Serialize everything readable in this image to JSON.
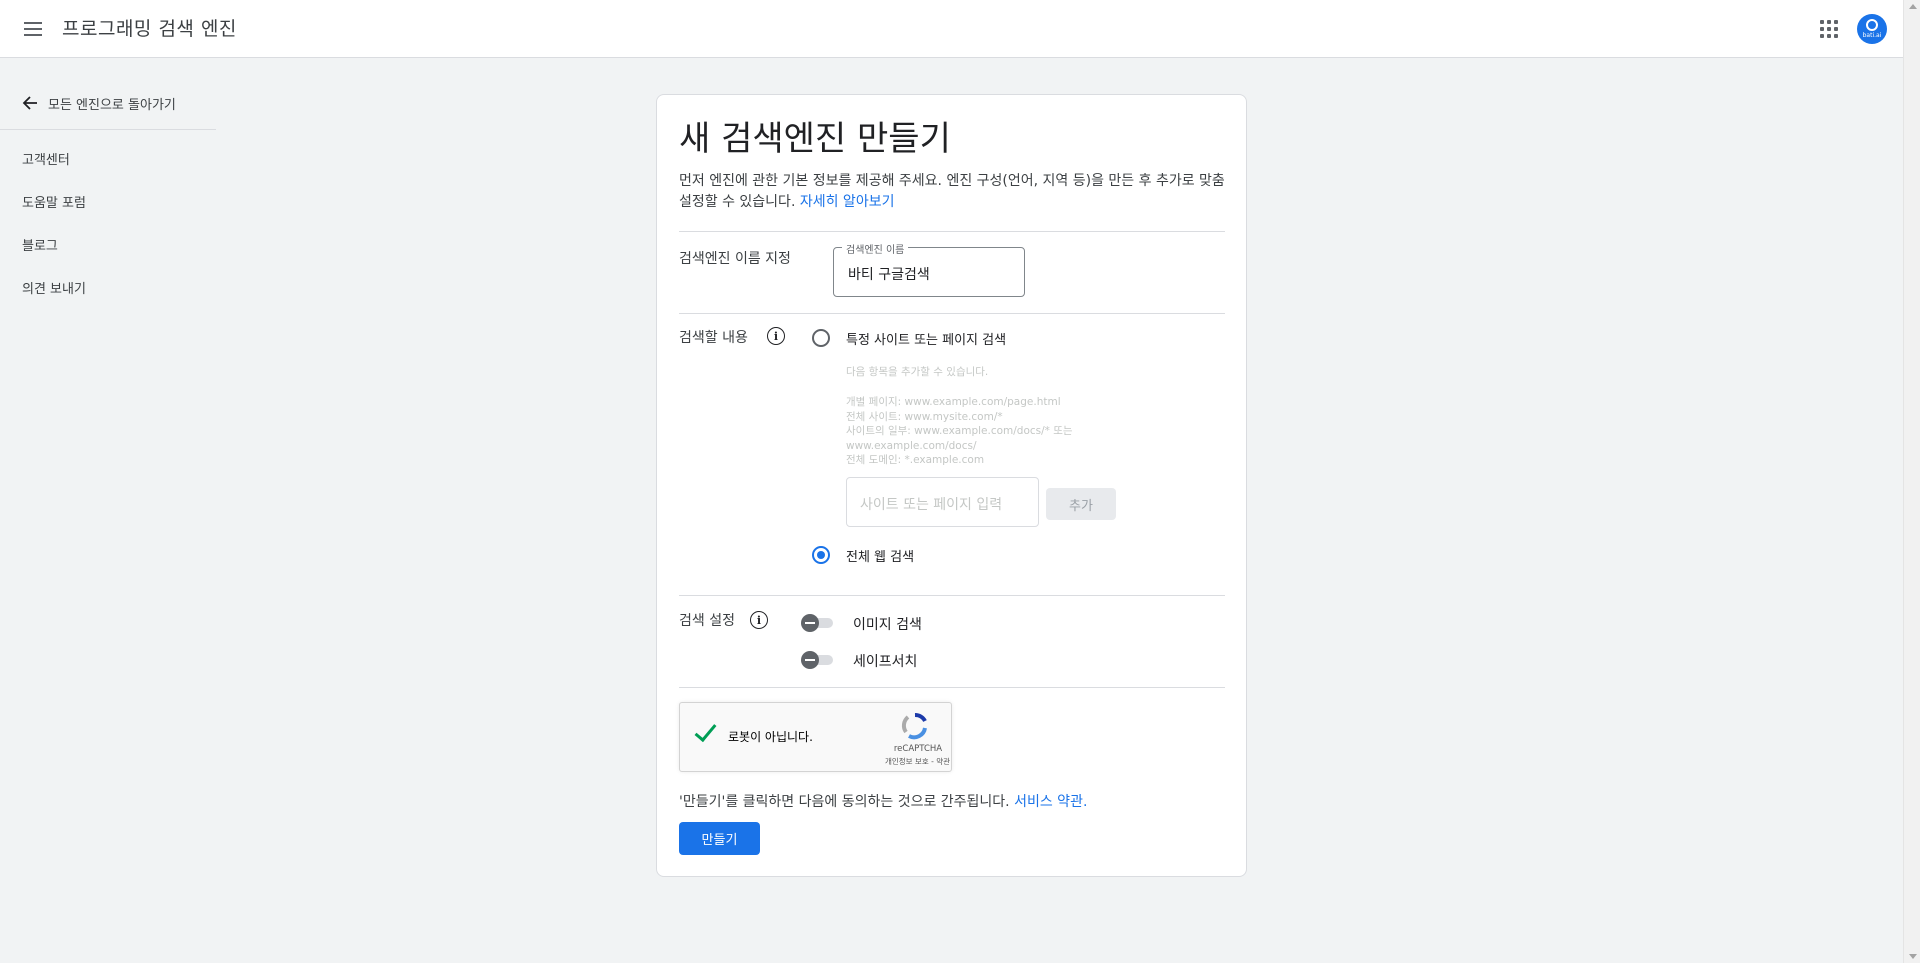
{
  "header": {
    "app_title": "프로그래밍 검색 엔진",
    "avatar_text": "bati.ai",
    "icons": {
      "menu": "hamburger-menu-icon",
      "apps": "apps-grid-icon"
    }
  },
  "sidebar": {
    "back_label": "모든 엔진으로 돌아가기",
    "items": [
      {
        "label": "고객센터"
      },
      {
        "label": "도움말 포럼"
      },
      {
        "label": "블로그"
      },
      {
        "label": "의견 보내기"
      }
    ]
  },
  "form": {
    "title": "새 검색엔진 만들기",
    "intro": "먼저 엔진에 관한 기본 정보를 제공해 주세요. 엔진 구성(언어, 지역 등)을 만든 후 추가로 맞춤설정할 수 있습니다.",
    "learn_more": "자세히 알아보기",
    "name_section": {
      "label": "검색엔진 이름 지정",
      "field_label": "검색엔진 이름",
      "field_value": "바티 구글검색"
    },
    "search_section": {
      "label": "검색할 내용",
      "option_specific": "특정 사이트 또는 페이지 검색",
      "hint_intro": "다음 항목을 추가할 수 있습니다.",
      "hints": [
        "개별 페이지: www.example.com/page.html",
        "전체 사이트: www.mysite.com/*",
        "사이트의 일부: www.example.com/docs/* 또는",
        "www.example.com/docs/",
        "전체 도메인: *.example.com"
      ],
      "site_placeholder": "사이트 또는 페이지 입력",
      "add_label": "추가",
      "option_entire_web": "전체 웹 검색",
      "selected_option": "전체 웹 검색"
    },
    "settings_section": {
      "label": "검색 설정",
      "image_search": "이미지 검색",
      "image_search_enabled": false,
      "safesearch": "세이프서치",
      "safesearch_enabled": false
    },
    "captcha": {
      "label": "로봇이 아닙니다.",
      "brand": "reCAPTCHA",
      "terms": "개인정보 보호 - 약관",
      "checked": true
    },
    "consent_text": "'만들기'를 클릭하면 다음에 동의하는 것으로 간주됩니다.",
    "terms_link": "서비스 약관",
    "terms_period": ".",
    "create_label": "만들기"
  },
  "colors": {
    "accent": "#1a73e8",
    "captcha_check": "#009e55",
    "background": "#f1f3f4"
  }
}
